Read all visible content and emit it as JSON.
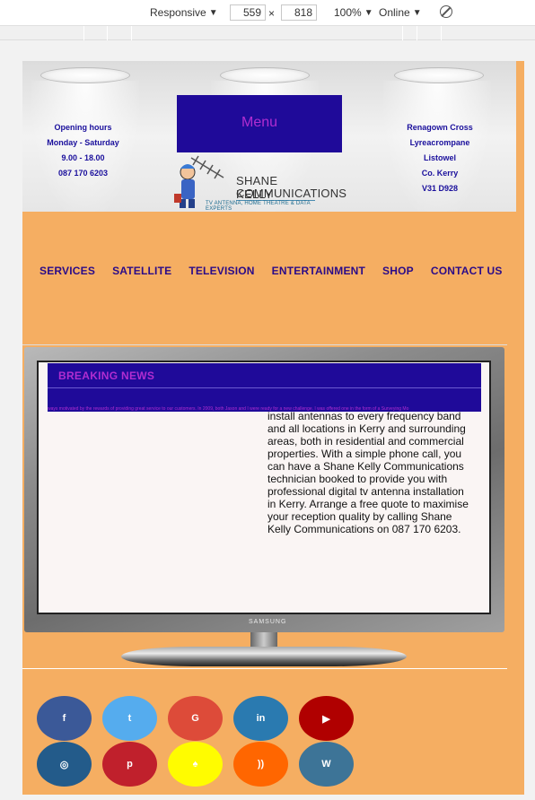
{
  "devtools": {
    "device": "Responsive",
    "width": "559",
    "height": "818",
    "x_sep": "×",
    "zoom": "100%",
    "network": "Online"
  },
  "header": {
    "hours_lines": [
      "Opening hours",
      "Monday - Saturday",
      "9.00 - 18.00",
      "087 170 6203"
    ],
    "address_lines": [
      "Renagown Cross",
      "Lyreacrompane",
      "Listowel",
      "Co. Kerry",
      "V31 D928"
    ],
    "menu_label": "Menu",
    "logo": {
      "name_line1": "SHANE KELLY",
      "name_line2": "COMMUNICATIONS",
      "tagline": "TV ANTENNA, HOME THEATRE & DATA EXPERTS"
    }
  },
  "nav": [
    "SERVICES",
    "SATELLITE",
    "TELEVISION",
    "ENTERTAINMENT",
    "SHOP",
    "CONTACT US"
  ],
  "tv": {
    "brand": "SAMSUNG",
    "news_title": "BREAKING NEWS",
    "ticker": "ways motivated by the rewards of providing great service to our customers. In 2009, both Jason and I were ready for a new challenge. I was offered one in the form of a Surveying Mo",
    "body": "install antennas to every frequency band and all locations in Kerry and surrounding areas, both in residential and commercial properties. With a simple phone call, you can have a Shane Kelly Communications technician booked to provide you with professional digital tv antenna installation in Kerry. Arrange a free quote to maximise your reception quality by calling Shane Kelly Communications on 087 170 6203."
  },
  "social": [
    {
      "name": "facebook",
      "glyph": "f",
      "color": "#3b5998"
    },
    {
      "name": "twitter",
      "glyph": "t",
      "color": "#55acee"
    },
    {
      "name": "google-plus",
      "glyph": "G",
      "color": "#dd4b39"
    },
    {
      "name": "linkedin",
      "glyph": "in",
      "color": "#2a7ab0"
    },
    {
      "name": "youtube",
      "glyph": "▶",
      "color": "#b00000"
    },
    {
      "name": "instagram",
      "glyph": "◎",
      "color": "#235b8a"
    },
    {
      "name": "pinterest",
      "glyph": "p",
      "color": "#c0202c"
    },
    {
      "name": "snapchat",
      "glyph": "♠",
      "color": "#fffc00"
    },
    {
      "name": "rss",
      "glyph": "))",
      "color": "#ff6600"
    },
    {
      "name": "wordpress",
      "glyph": "W",
      "color": "#3d7497"
    }
  ]
}
